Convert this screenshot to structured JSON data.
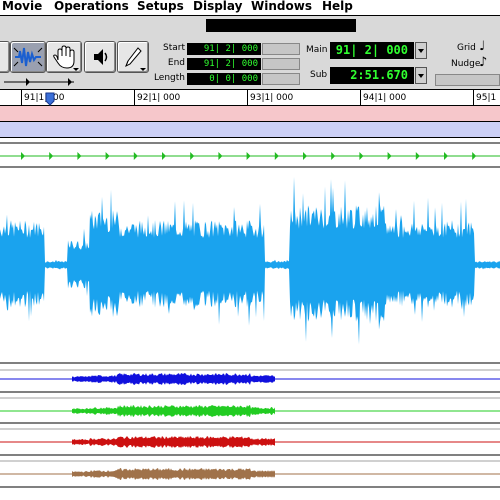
{
  "menu": {
    "items": [
      "Movie",
      "Operations",
      "Setups",
      "Display",
      "Windows",
      "Help"
    ]
  },
  "toolbar": {
    "tools": [
      {
        "icon": "zoom-icon"
      },
      {
        "icon": "trim-waveform-icon",
        "active": true
      },
      {
        "icon": "grabber-hand-icon"
      },
      {
        "icon": "speaker-scrub-icon"
      },
      {
        "icon": "pencil-icon"
      }
    ],
    "start_label": "Start",
    "start_value": "91| 2| 000",
    "end_label": "End",
    "end_value": "91| 2| 000",
    "length_label": "Length",
    "length_value": "0| 0| 000",
    "main_label": "Main",
    "main_value": "91| 2| 000",
    "sub_label": "Sub",
    "sub_value": "2:51.670",
    "grid_label": "Grid",
    "nudge_label": "Nudge"
  },
  "ruler": {
    "labels": [
      "91|1|000",
      "92|1| 000",
      "93|1| 000",
      "94|1| 000",
      "95|1"
    ]
  },
  "colors": {
    "waveform": "#1aa3ee",
    "tempo_markers": "#22bb22",
    "track_blue": "#1010dd",
    "track_green": "#22cc22",
    "track_red": "#cc1010",
    "track_brown": "#a0724a",
    "band_pink": "#f6c7cb",
    "band_lavender": "#ccd0f6",
    "counter_text": "#30ff30"
  }
}
